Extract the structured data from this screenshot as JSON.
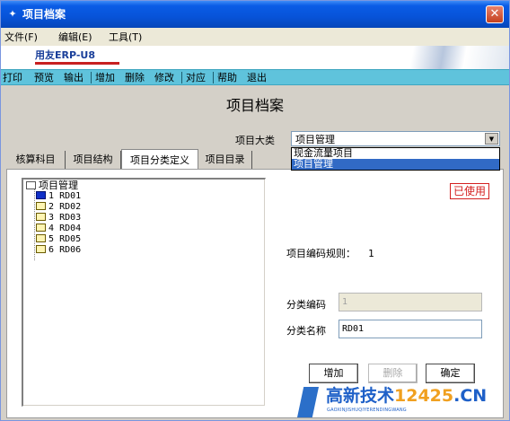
{
  "window": {
    "title": "项目档案",
    "close_glyph": "✕"
  },
  "menu": {
    "items": [
      "文件(F)",
      "编辑(E)",
      "工具(T)"
    ]
  },
  "banner": {
    "logo": "用友ERP-U8"
  },
  "toolbar": {
    "items": [
      "打印",
      "预览",
      "输出",
      "增加",
      "删除",
      "修改",
      "对应",
      "帮助",
      "退出"
    ]
  },
  "header": {
    "title": "项目档案",
    "type_label": "项目大类",
    "type_value": "项目管理"
  },
  "dropdown": {
    "options": [
      "现金流量项目",
      "项目管理"
    ],
    "selected": "项目管理"
  },
  "tabs": [
    "核算科目",
    "项目结构",
    "项目分类定义",
    "项目目录"
  ],
  "active_tab": "项目分类定义",
  "tree": {
    "root": "项目管理",
    "children": [
      {
        "num": "1",
        "code": "RD01"
      },
      {
        "num": "2",
        "code": "RD02"
      },
      {
        "num": "3",
        "code": "RD03"
      },
      {
        "num": "4",
        "code": "RD04"
      },
      {
        "num": "5",
        "code": "RD05"
      },
      {
        "num": "6",
        "code": "RD06"
      }
    ]
  },
  "detail": {
    "used_badge": "已使用",
    "rule_label": "项目编码规则：",
    "rule_value": "1",
    "code_label": "分类编码",
    "code_value": "1",
    "name_label": "分类名称",
    "name_value": "RD01",
    "add_button": "增加",
    "delete_button": "删除",
    "confirm_button": "确定"
  },
  "watermark": {
    "text": "高新技术",
    "number": "12425",
    "suffix": ".CN",
    "sub": "GAOXINJISHUQIYERENDINGWANG"
  },
  "colors": {
    "titlebar": "#0753d8",
    "toolbar": "#5fc3dc",
    "selection": "#316ac5",
    "badge": "#d42020"
  }
}
